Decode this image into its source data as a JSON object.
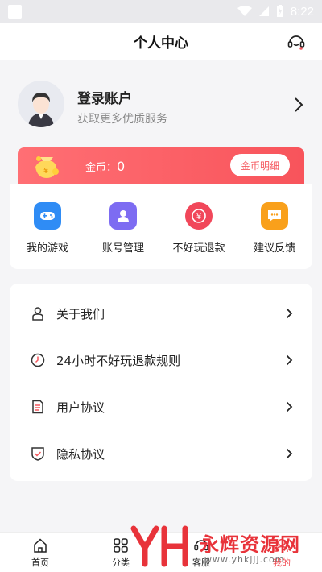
{
  "status_bar": {
    "time": "8:22"
  },
  "header": {
    "title": "个人中心"
  },
  "profile": {
    "name": "登录账户",
    "subtitle": "获取更多优质服务"
  },
  "coins": {
    "label": "金币：",
    "value": "0",
    "detail_button": "金币明细"
  },
  "quick_actions": [
    {
      "label": "我的游戏",
      "icon": "gamepad-icon",
      "color": "#2f8cf5"
    },
    {
      "label": "账号管理",
      "icon": "user-icon",
      "color": "#7d6cf2"
    },
    {
      "label": "不好玩退款",
      "icon": "yuan-coin-icon",
      "color": "#f1475a"
    },
    {
      "label": "建议反馈",
      "icon": "chat-bubble-icon",
      "color": "#f9a01b"
    }
  ],
  "menu": [
    {
      "label": "关于我们",
      "icon": "person-outline-icon"
    },
    {
      "label": "24小时不好玩退款规则",
      "icon": "clock-icon"
    },
    {
      "label": "用户协议",
      "icon": "document-icon"
    },
    {
      "label": "隐私协议",
      "icon": "shield-check-icon"
    }
  ],
  "tabbar": [
    {
      "label": "首页",
      "icon": "home-icon",
      "active": false
    },
    {
      "label": "分类",
      "icon": "grid-icon",
      "active": false
    },
    {
      "label": "客服",
      "icon": "headset-icon",
      "active": false
    },
    {
      "label": "我的",
      "icon": "profile-icon",
      "active": true
    }
  ],
  "watermark": {
    "text": "永辉资源网",
    "url": "www.yhkjjj.com"
  },
  "colors": {
    "accent": "#f5575d",
    "background": "#f5f5f7"
  }
}
